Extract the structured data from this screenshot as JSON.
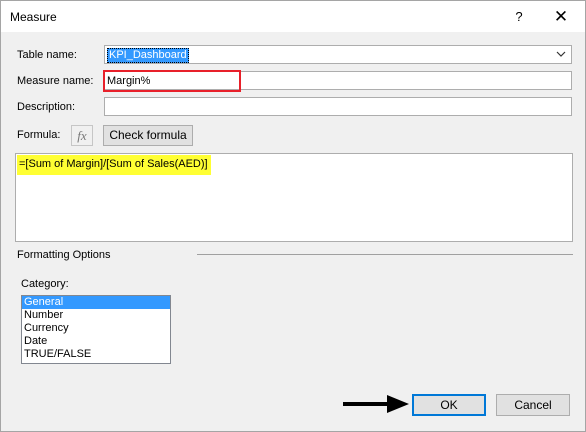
{
  "window": {
    "title": "Measure",
    "help": "?",
    "close": "✕"
  },
  "form": {
    "table_name_label": "Table name:",
    "table_name_value": "KPI_Dashboard",
    "measure_name_label": "Measure name:",
    "measure_name_value": "Margin%",
    "description_label": "Description:",
    "description_value": "",
    "formula_label": "Formula:",
    "fx_label": "fx",
    "check_formula_label": "Check formula",
    "formula_value": "=[Sum of Margin]/[Sum of Sales(AED)]"
  },
  "formatting": {
    "section_label": "Formatting Options",
    "category_label": "Category:",
    "categories": [
      "General",
      "Number",
      "Currency",
      "Date",
      "TRUE/FALSE"
    ],
    "selected_category": "General"
  },
  "footer": {
    "ok_label": "OK",
    "cancel_label": "Cancel"
  },
  "colors": {
    "selection": "#3399ff",
    "highlight": "#ffff33",
    "annotation_box": "#e8202a"
  }
}
